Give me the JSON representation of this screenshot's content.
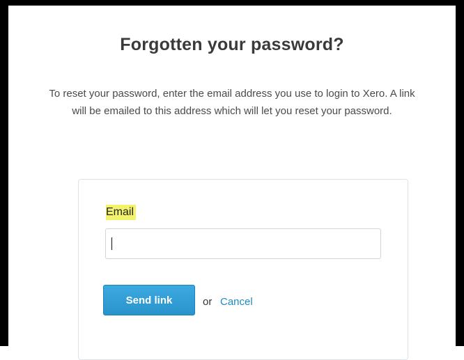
{
  "page": {
    "title": "Forgotten your password?",
    "intro": "To reset your password, enter the email address you use to login to Xero. A link will be emailed to this address which will let you reset your password."
  },
  "form": {
    "email_label": "Email",
    "email_value": "",
    "send_label": "Send link",
    "or_text": "or",
    "cancel_label": "Cancel"
  },
  "colors": {
    "button": "#2a93cc",
    "link": "#1f8ac4",
    "label_highlight": "#f3f36b"
  }
}
